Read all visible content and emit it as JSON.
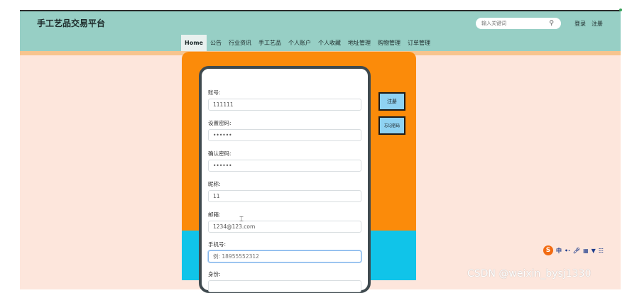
{
  "header": {
    "site_title": "手工艺品交易平台",
    "search_placeholder": "输入关键词",
    "search_icon": "search-icon",
    "login_label": "登录",
    "register_label": "注册"
  },
  "nav": {
    "items": [
      "Home",
      "公告",
      "行业资讯",
      "手工艺品",
      "个人账户",
      "个人收藏",
      "地址管理",
      "购物管理",
      "订单管理"
    ],
    "active": "Home"
  },
  "form": {
    "fields": [
      {
        "label": "账号:",
        "value": "111111",
        "placeholder": ""
      },
      {
        "label": "设置密码:",
        "value": "••••••",
        "placeholder": ""
      },
      {
        "label": "确认密码:",
        "value": "••••••",
        "placeholder": ""
      },
      {
        "label": "昵称:",
        "value": "11",
        "placeholder": ""
      },
      {
        "label": "邮箱:",
        "value": "1234@123.com",
        "placeholder": ""
      },
      {
        "label": "手机号:",
        "value": "",
        "placeholder": "例: 18955552312"
      },
      {
        "label": "身份:",
        "value": "",
        "placeholder": ""
      }
    ]
  },
  "buttons": {
    "register": "注册",
    "forgot_password": "忘记密码"
  },
  "ime": {
    "logo": "S",
    "lang": "中",
    "icons": [
      "punctuation-icon",
      "mic-icon",
      "keyboard-icon",
      "skin-icon",
      "grid-icon"
    ]
  },
  "watermark": "CSDN @weixin_bysj1330",
  "colors": {
    "header_bg": "#97cfc5",
    "page_bg": "#fde6dc",
    "panel_orange": "#fb8b0a",
    "panel_blue": "#10c4e9",
    "button_bg": "#8fd2f2"
  }
}
